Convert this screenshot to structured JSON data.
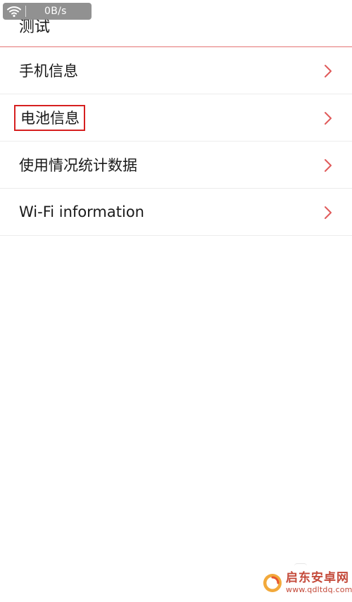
{
  "status": {
    "speed": "0B/s",
    "wifi_icon": "wifi-icon"
  },
  "header": {
    "title": "测试"
  },
  "list": {
    "items": [
      {
        "label": "手机信息",
        "icon": "chevron-right-icon"
      },
      {
        "label": "电池信息",
        "icon": "chevron-right-icon",
        "highlighted": true
      },
      {
        "label": "使用情况统计数据",
        "icon": "chevron-right-icon"
      },
      {
        "label": "Wi-Fi information",
        "icon": "chevron-right-icon"
      }
    ]
  },
  "watermark": {
    "name": "启东安卓网",
    "url": "www.qdltdq.com"
  },
  "colors": {
    "accent": "#e57373",
    "chevron": "#e05a5a",
    "highlight_box": "#d62020"
  }
}
